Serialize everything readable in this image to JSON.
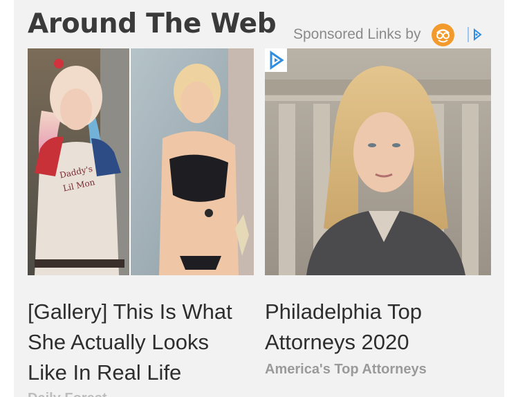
{
  "widget": {
    "heading": "Around The Web",
    "sponsored_label": "Sponsored Links by",
    "icons": {
      "publisher": "outbrain-reader-icon",
      "ad_choices": "adchoices-icon"
    }
  },
  "cards": [
    {
      "title": "[Gallery] This Is What She Actually Looks Like In Real Life",
      "source": "Daily Forest",
      "image": "photo of a blonde woman in a costume and in a swimsuit, side by side"
    },
    {
      "title": "Philadelphia Top Attorneys 2020",
      "source": "America's Top Attorneys",
      "image": "photo of a blonde woman in a dark blazer in front of a columned courthouse",
      "overlay_icon": "play-badge-icon"
    }
  ],
  "colors": {
    "panel_bg": "#f2f2f2",
    "accent_orange": "#f39a2c",
    "accent_blue": "#2f8ee0"
  }
}
